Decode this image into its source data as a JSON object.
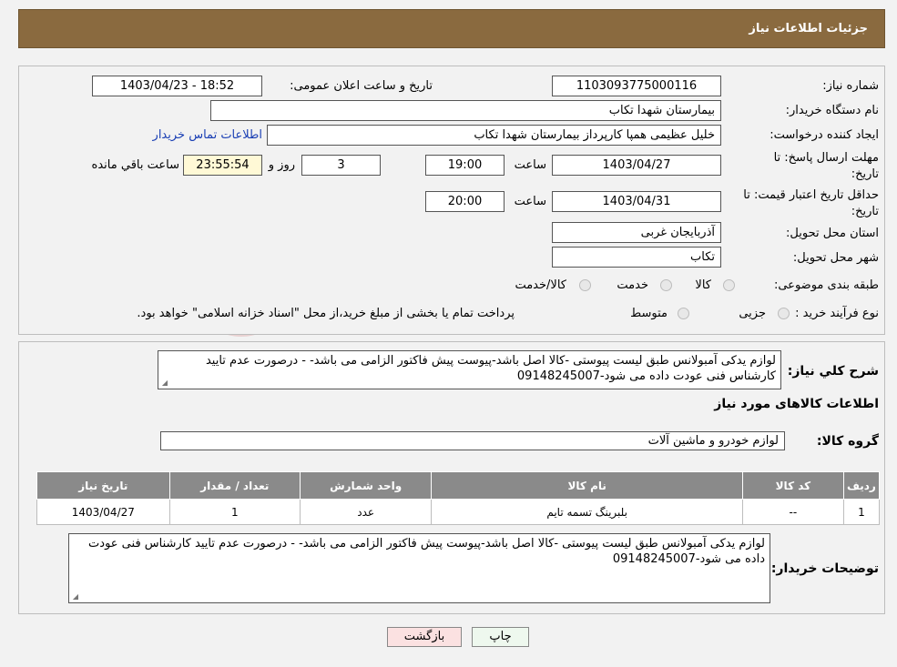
{
  "header": {
    "title": "جزئیات اطلاعات نیاز"
  },
  "form": {
    "need_number_label": "شماره نیاز:",
    "need_number": "1103093775000116",
    "announce_label": "تاریخ و ساعت اعلان عمومی:",
    "announce_value": "1403/04/23 - 18:52",
    "buyer_org_label": "نام دستگاه خریدار:",
    "buyer_org": "بیمارستان شهدا تکاب",
    "creator_label": "ایجاد کننده درخواست:",
    "creator": "خلیل عظیمی همپا کارپرداز بیمارستان شهدا تکاب",
    "contact_link": "اطلاعات تماس خریدار",
    "deadline_label_1": "مهلت ارسال پاسخ: تا",
    "deadline_label_2": "تاریخ:",
    "deadline_date": "1403/04/27",
    "time_label": "ساعت",
    "deadline_time": "19:00",
    "days_value": "3",
    "days_label": "روز و",
    "remaining_time": "23:55:54",
    "remaining_label": "ساعت باقي مانده",
    "validity_label_1": "حداقل تاریخ اعتبار قیمت: تا",
    "validity_label_2": "تاریخ:",
    "validity_date": "1403/04/31",
    "validity_time": "20:00",
    "province_label": "استان محل تحویل:",
    "province": "آذربایجان غربی",
    "city_label": "شهر محل تحویل:",
    "city": "تکاب",
    "category_label": "طبقه بندی موضوعی:",
    "category_options": [
      "کالا",
      "خدمت",
      "کالا/خدمت"
    ],
    "process_label": "نوع فرآیند خرید :",
    "process_options": [
      "جزیی",
      "متوسط"
    ],
    "process_note": "پرداخت تمام یا بخشی از مبلغ خرید،از محل \"اسناد خزانه اسلامی\" خواهد بود."
  },
  "description": {
    "label": "شرح کلي نياز:",
    "text": "لوازم یدکی آمبولانس طبق لیست پیوستی -کالا اصل باشد-پیوست پیش فاکتور الزامی می باشد- - درصورت عدم تایید کارشناس فنی عودت داده می شود-09148245007"
  },
  "goods": {
    "section_title": "اطلاعات کالاهای مورد نیاز",
    "group_label": "گروه کالا:",
    "group_value": "لوازم خودرو و ماشین آلات",
    "columns": [
      "ردیف",
      "کد کالا",
      "نام کالا",
      "واحد شمارش",
      "تعداد / مقدار",
      "تاریخ نیاز"
    ],
    "rows": [
      {
        "row": "1",
        "code": "--",
        "name": "بلبرینگ تسمه تایم",
        "unit": "عدد",
        "qty": "1",
        "date": "1403/04/27"
      }
    ]
  },
  "buyer_notes": {
    "label": "توضیحات خریدار:",
    "text": "لوازم یدکی آمبولانس طبق لیست پیوستی -کالا اصل باشد-پیوست پیش فاکتور الزامی می باشد- - درصورت عدم تایید کارشناس فنی عودت داده می شود-09148245007"
  },
  "buttons": {
    "print": "چاپ",
    "back": "بازگشت"
  },
  "watermark": {
    "text": "AriaTender.neT"
  },
  "colors": {
    "header_bg": "#8a6a3f",
    "table_header_bg": "#8a8a8a",
    "link": "#1a3fb4",
    "back_button_bg": "#fbe1e1"
  }
}
